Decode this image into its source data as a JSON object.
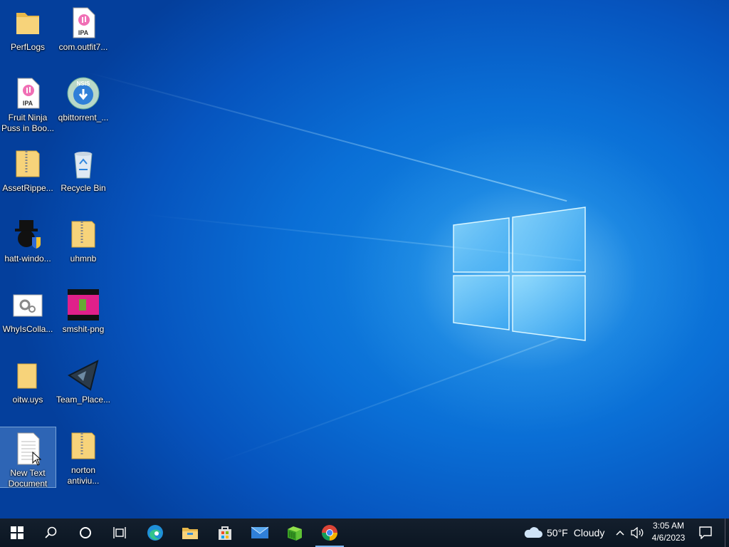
{
  "desktop": {
    "icons": [
      {
        "label": "PerfLogs",
        "icon": "folder-icon"
      },
      {
        "label": "com.outfit7...",
        "icon": "ipa-file-icon",
        "badge": "IPA"
      },
      {
        "label": "Fruit Ninja Puss in Boo...",
        "icon": "ipa-file-icon",
        "badge": "IPA"
      },
      {
        "label": "qbittorrent_...",
        "icon": "nsis-installer-icon",
        "badge": "NSIS"
      },
      {
        "label": "AssetRippe...",
        "icon": "zip-folder-icon"
      },
      {
        "label": "Recycle Bin",
        "icon": "recycle-bin-icon"
      },
      {
        "label": "hatt-windo...",
        "icon": "shield-app-icon"
      },
      {
        "label": "uhmnb",
        "icon": "zip-folder-icon"
      },
      {
        "label": "WhyIsColla...",
        "icon": "settings-file-icon"
      },
      {
        "label": "smshit-png",
        "icon": "image-thumbnail-icon"
      },
      {
        "label": "oitw.uys",
        "icon": "folder-icon"
      },
      {
        "label": "Team_Place...",
        "icon": "team-place-icon"
      },
      {
        "label": "New Text Document",
        "icon": "text-document-icon"
      },
      {
        "label": "norton antiviu...",
        "icon": "zip-folder-icon"
      }
    ]
  },
  "taskbar": {
    "apps": [
      {
        "name": "start-button",
        "icon": "windows-start-icon"
      },
      {
        "name": "search-button",
        "icon": "search-icon"
      },
      {
        "name": "cortana-button",
        "icon": "cortana-circle-icon"
      },
      {
        "name": "task-view-button",
        "icon": "task-view-icon"
      },
      {
        "name": "edge-app",
        "icon": "edge-icon"
      },
      {
        "name": "file-explorer-app",
        "icon": "file-explorer-icon"
      },
      {
        "name": "store-app",
        "icon": "microsoft-store-icon"
      },
      {
        "name": "mail-app",
        "icon": "mail-icon"
      },
      {
        "name": "minecraft-app",
        "icon": "green-app-icon"
      },
      {
        "name": "chrome-app",
        "icon": "chrome-icon"
      }
    ],
    "weather": {
      "temp": "50°F",
      "condition": "Cloudy"
    },
    "clock": {
      "time": "3:05 AM",
      "date": "4/6/2023"
    }
  },
  "colors": {
    "accent": "#0a6fd6",
    "taskbar": "#0d1b2a",
    "active_indicator": "#7db6f0"
  }
}
